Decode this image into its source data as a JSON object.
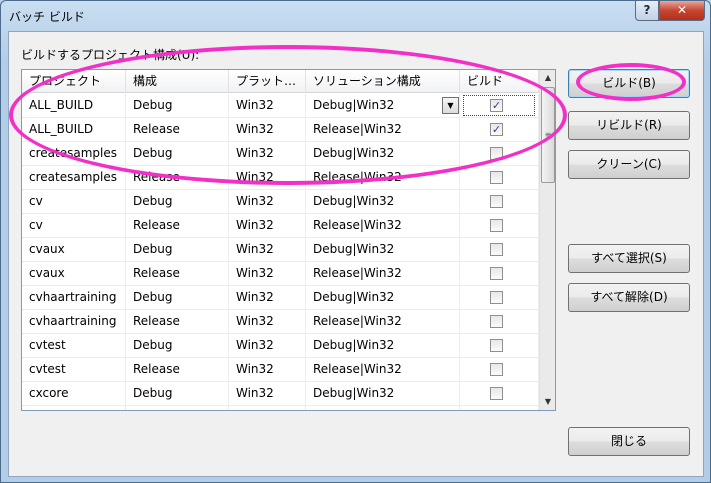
{
  "window": {
    "title": "バッチ ビルド",
    "help_glyph": "?",
    "close_glyph": "✕"
  },
  "group_label": "ビルドするプロジェクト構成(U):",
  "columns": [
    "プロジェクト",
    "構成",
    "プラット…",
    "ソリューション構成",
    "ビルド"
  ],
  "rows": [
    {
      "project": "ALL_BUILD",
      "config": "Debug",
      "platform": "Win32",
      "solution": "Debug|Win32",
      "build": "✓"
    },
    {
      "project": "ALL_BUILD",
      "config": "Release",
      "platform": "Win32",
      "solution": "Release|Win32",
      "build": "✓"
    },
    {
      "project": "createsamples",
      "config": "Debug",
      "platform": "Win32",
      "solution": "Debug|Win32",
      "build": ""
    },
    {
      "project": "createsamples",
      "config": "Release",
      "platform": "Win32",
      "solution": "Release|Win32",
      "build": ""
    },
    {
      "project": "cv",
      "config": "Debug",
      "platform": "Win32",
      "solution": "Debug|Win32",
      "build": ""
    },
    {
      "project": "cv",
      "config": "Release",
      "platform": "Win32",
      "solution": "Release|Win32",
      "build": ""
    },
    {
      "project": "cvaux",
      "config": "Debug",
      "platform": "Win32",
      "solution": "Debug|Win32",
      "build": ""
    },
    {
      "project": "cvaux",
      "config": "Release",
      "platform": "Win32",
      "solution": "Release|Win32",
      "build": ""
    },
    {
      "project": "cvhaartraining",
      "config": "Debug",
      "platform": "Win32",
      "solution": "Debug|Win32",
      "build": ""
    },
    {
      "project": "cvhaartraining",
      "config": "Release",
      "platform": "Win32",
      "solution": "Release|Win32",
      "build": ""
    },
    {
      "project": "cvtest",
      "config": "Debug",
      "platform": "Win32",
      "solution": "Debug|Win32",
      "build": ""
    },
    {
      "project": "cvtest",
      "config": "Release",
      "platform": "Win32",
      "solution": "Release|Win32",
      "build": ""
    },
    {
      "project": "cxcore",
      "config": "Debug",
      "platform": "Win32",
      "solution": "Debug|Win32",
      "build": ""
    },
    {
      "project": "",
      "config": "",
      "platform": "",
      "solution": "",
      "build": ""
    }
  ],
  "dropdown_glyph": "▼",
  "scrollbar": {
    "up": "▲",
    "down": "▼",
    "grip": "≡"
  },
  "buttons": {
    "build": "ビルド(B)",
    "rebuild": "リビルド(R)",
    "clean": "クリーン(C)",
    "select_all": "すべて選択(S)",
    "deselect_all": "すべて解除(D)",
    "close": "閉じる"
  },
  "colors": {
    "highlight": "#f22fc6",
    "check": "#2a3f88"
  }
}
